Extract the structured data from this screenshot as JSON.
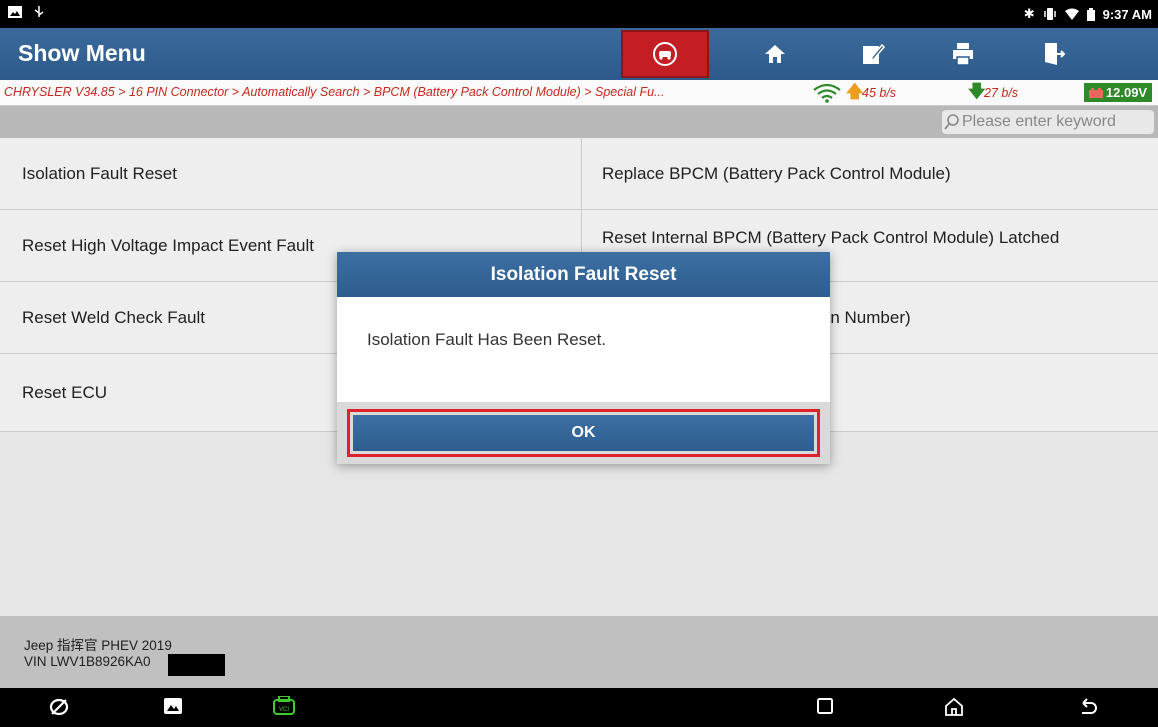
{
  "statusbar": {
    "time": "9:37 AM",
    "icons": [
      "image-icon",
      "usb-icon",
      "bluetooth-icon",
      "vibrate-icon",
      "wifi-icon",
      "battery-icon"
    ]
  },
  "titlebar": {
    "title": "Show Menu",
    "buttons": [
      "car-diagnose-icon",
      "home-icon",
      "edit-icon",
      "print-icon",
      "exit-icon"
    ]
  },
  "breadcrumb": {
    "path": "CHRYSLER V34.85 > 16 PIN Connector > Automatically Search > BPCM (Battery Pack Control Module) > Special Fu...",
    "upload_speed": "45 b/s",
    "download_speed": "27 b/s",
    "battery_voltage": "12.09V"
  },
  "search": {
    "placeholder": "Please enter keyword"
  },
  "menu": {
    "left": [
      "Isolation Fault Reset",
      "Reset High Voltage Impact Event Fault",
      "Reset Weld Check Fault",
      "Reset ECU"
    ],
    "right": [
      "Replace BPCM (Battery Pack Control Module)",
      "Reset Internal BPCM (Battery Pack Control Module) Latched",
      "Write VIN (Vehicle Identification Number)",
      ""
    ]
  },
  "vehicle": {
    "name": "Jeep 指挥官 PHEV 2019",
    "vin": "VIN LWV1B8926KA0"
  },
  "dialog": {
    "title": "Isolation Fault Reset",
    "message": "Isolation Fault Has Been Reset.",
    "ok_label": "OK"
  },
  "colors": {
    "header_blue": "#2d5a8a",
    "alert_red": "#c41e24",
    "breadcrumb_red": "#c82a1f",
    "battery_green": "#2f8d2a",
    "highlight_red": "#e0202a"
  }
}
